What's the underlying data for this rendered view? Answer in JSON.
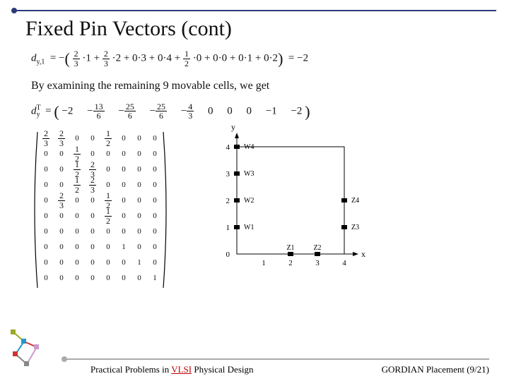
{
  "title": "Fixed Pin Vectors (cont)",
  "eq1": {
    "lhs_var": "d",
    "lhs_sub": "y,1",
    "terms": "= −( 2/3 ·1 + 2/3 ·2 + 0·3 + 0·4 + 1/2 ·0 + 0·0 + 0·1 + 0·2 ) = −2",
    "f1n": "2",
    "f1d": "3",
    "f2n": "2",
    "f2d": "3",
    "f3n": "1",
    "f3d": "2",
    "rhs": "−2"
  },
  "explain": "By examining the remaining 9 movable cells, we get",
  "eq2": {
    "lhs_var": "d",
    "lhs_sup": "T",
    "lhs_sub": "y",
    "vals": [
      "−2",
      "−13/6",
      "−25/6",
      "−25/6",
      "−4/3",
      "0",
      "0",
      "0",
      "−1",
      "−2"
    ],
    "f0": {
      "n": "13",
      "d": "6"
    },
    "f1": {
      "n": "25",
      "d": "6"
    },
    "f2": {
      "n": "25",
      "d": "6"
    },
    "f3": {
      "n": "4",
      "d": "3"
    }
  },
  "matrix": [
    [
      "2/3",
      "2/3",
      "0",
      "0",
      "1/2",
      "0",
      "0",
      "0"
    ],
    [
      "0",
      "0",
      "1/2",
      "0",
      "0",
      "0",
      "0",
      "0"
    ],
    [
      "0",
      "0",
      "1/2",
      "2/3",
      "0",
      "0",
      "0",
      "0"
    ],
    [
      "0",
      "0",
      "1/2",
      "2/3",
      "0",
      "0",
      "0",
      "0"
    ],
    [
      "0",
      "2/3",
      "0",
      "0",
      "1/2",
      "0",
      "0",
      "0"
    ],
    [
      "0",
      "0",
      "0",
      "0",
      "1/2",
      "0",
      "0",
      "0"
    ],
    [
      "0",
      "0",
      "0",
      "0",
      "0",
      "0",
      "0",
      "0"
    ],
    [
      "0",
      "0",
      "0",
      "0",
      "0",
      "1",
      "0",
      "0"
    ],
    [
      "0",
      "0",
      "0",
      "0",
      "0",
      "0",
      "1",
      "0"
    ],
    [
      "0",
      "0",
      "0",
      "0",
      "0",
      "0",
      "0",
      "1"
    ]
  ],
  "diagram": {
    "xlabel": "x",
    "ylabel": "y",
    "xticks": [
      "1",
      "2",
      "3",
      "4"
    ],
    "yticks": [
      "0",
      "1",
      "2",
      "3",
      "4"
    ],
    "points": [
      {
        "label": "W4",
        "x": 0,
        "y": 4,
        "side": "left"
      },
      {
        "label": "W3",
        "x": 0,
        "y": 3,
        "side": "left"
      },
      {
        "label": "W2",
        "x": 0,
        "y": 2,
        "side": "left"
      },
      {
        "label": "W1",
        "x": 0,
        "y": 1,
        "side": "left"
      },
      {
        "label": "Z1",
        "x": 2,
        "y": 0,
        "side": "bottom"
      },
      {
        "label": "Z2",
        "x": 3,
        "y": 0,
        "side": "bottom"
      },
      {
        "label": "Z4",
        "x": 4,
        "y": 2,
        "side": "right"
      },
      {
        "label": "Z3",
        "x": 4,
        "y": 1,
        "side": "right"
      }
    ]
  },
  "footer": {
    "left_pre": "Practical Problems in ",
    "left_vlsi": "VLSI",
    "left_post": " Physical Design",
    "right": "GORDIAN Placement (9/21)"
  }
}
